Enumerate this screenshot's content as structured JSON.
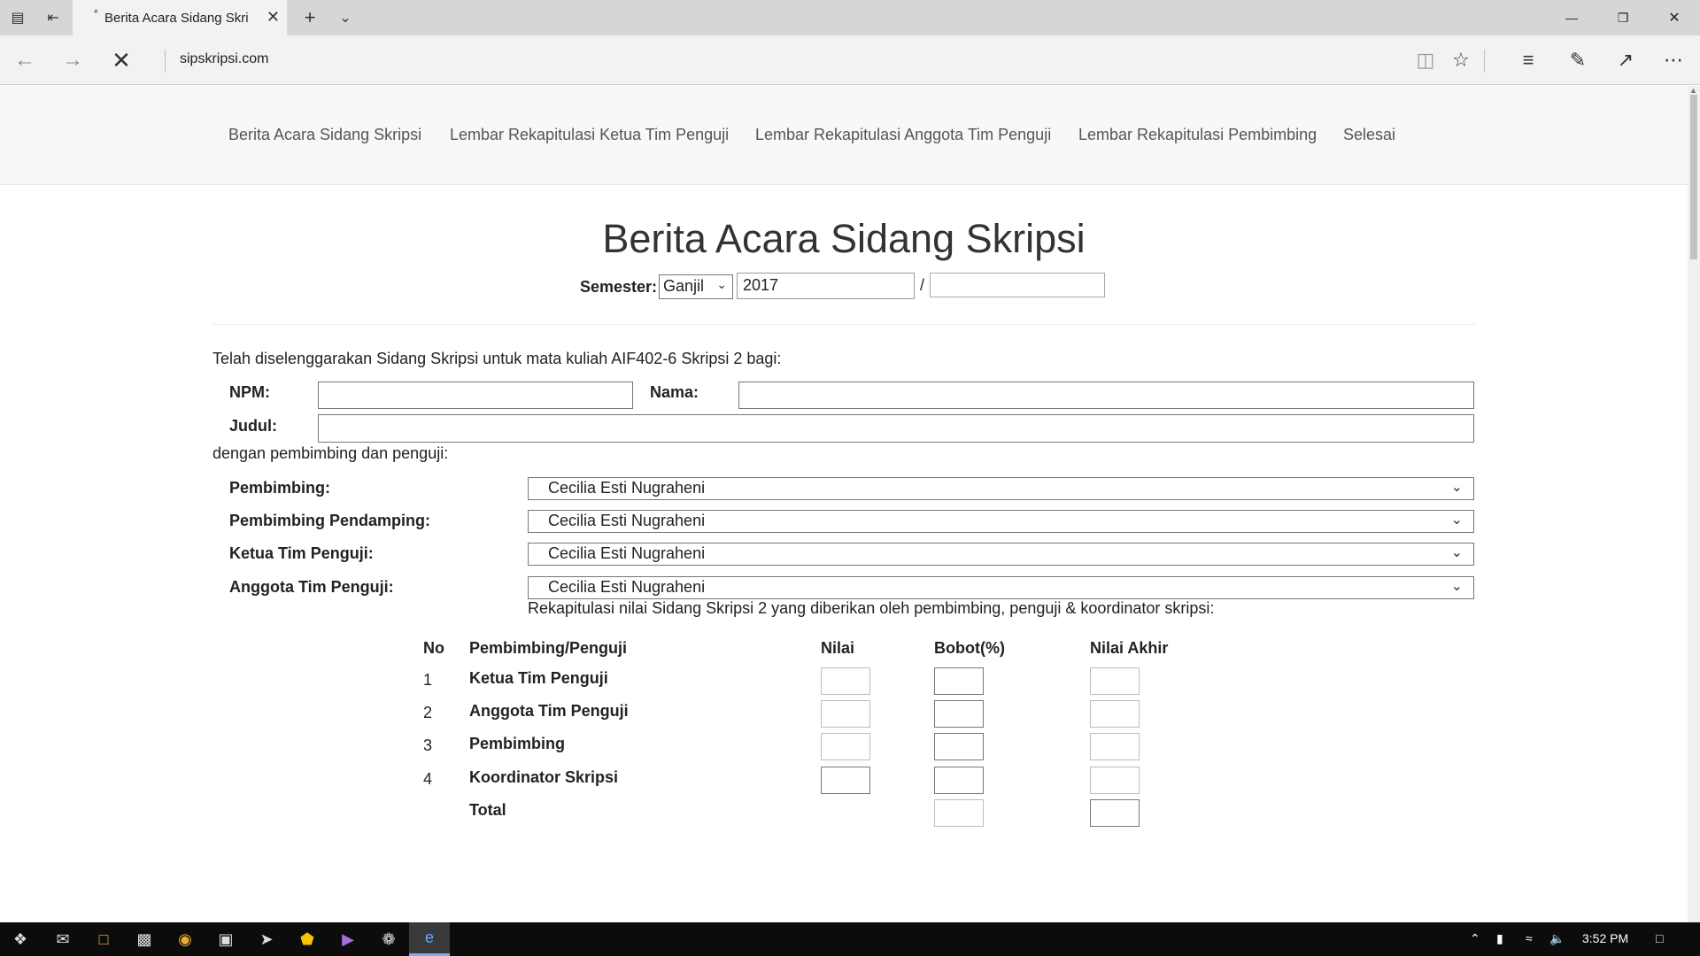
{
  "browser": {
    "tab_title": "Berita Acara Sidang Skri",
    "tab_loading_dot": "*",
    "url": "sipskripsi.com"
  },
  "site_nav": {
    "items": [
      "Berita Acara Sidang Skripsi",
      "Lembar Rekapitulasi Ketua Tim Penguji",
      "Lembar Rekapitulasi Anggota Tim Penguji",
      "Lembar Rekapitulasi Pembimbing",
      "Selesai"
    ]
  },
  "form": {
    "title": "Berita Acara Sidang Skripsi",
    "semester_label": "Semester:",
    "semester_value": "Ganjil",
    "year_start": "2017",
    "year_separator": "/",
    "year_end": "",
    "intro_text": "Telah diselenggarakan Sidang Skripsi untuk mata kuliah AIF402-6 Skripsi 2 bagi:",
    "npm_label": "NPM:",
    "npm_value": "",
    "nama_label": "Nama:",
    "nama_value": "",
    "judul_label": "Judul:",
    "judul_value": "",
    "pembimbing_intro": "dengan pembimbing dan penguji:",
    "roles": [
      {
        "label": "Pembimbing:",
        "value": "Cecilia Esti Nugraheni"
      },
      {
        "label": "Pembimbing Pendamping:",
        "value": "Cecilia Esti Nugraheni"
      },
      {
        "label": "Ketua Tim Penguji:",
        "value": "Cecilia Esti Nugraheni"
      },
      {
        "label": "Anggota Tim Penguji:",
        "value": "Cecilia Esti Nugraheni"
      }
    ],
    "recap_text": "Rekapitulasi nilai Sidang Skripsi 2 yang diberikan oleh pembimbing, penguji & koordinator skripsi:"
  },
  "grade_table": {
    "headers": {
      "no": "No",
      "person": "Pembimbing/Penguji",
      "nilai": "Nilai",
      "bobot": "Bobot(%)",
      "akhir": "Nilai Akhir"
    },
    "rows": [
      {
        "no": "1",
        "name": "Ketua Tim Penguji"
      },
      {
        "no": "2",
        "name": "Anggota Tim Penguji"
      },
      {
        "no": "3",
        "name": "Pembimbing"
      },
      {
        "no": "4",
        "name": "Koordinator Skripsi"
      }
    ],
    "total_label": "Total"
  },
  "taskbar": {
    "clock": "3:52 PM"
  }
}
